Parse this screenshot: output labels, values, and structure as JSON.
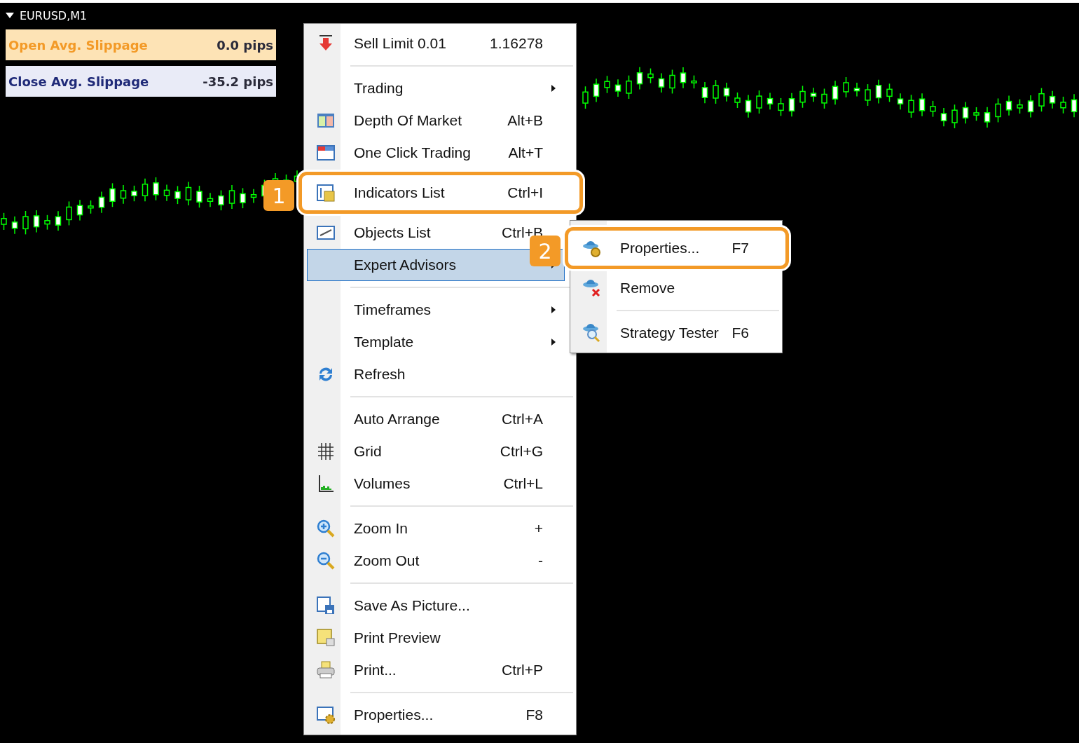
{
  "chart": {
    "symbol": "EURUSD,M1"
  },
  "slippage": [
    {
      "kind": "open",
      "label": "Open Avg. Slippage",
      "value": "0.0 pips",
      "color": "#f39a27"
    },
    {
      "kind": "close",
      "label": "Close Avg. Slippage",
      "value": "-35.2 pips",
      "color": "#1f2a78"
    }
  ],
  "context_menu": {
    "items": [
      {
        "kind": "item",
        "label": "Sell Limit 0.01",
        "shortcut": "1.16278",
        "submenu": false,
        "selected": false
      },
      {
        "kind": "separator"
      },
      {
        "kind": "item",
        "label": "Trading",
        "submenu": true,
        "selected": false
      },
      {
        "kind": "item",
        "label": "Depth Of Market",
        "shortcut": "Alt+B",
        "submenu": false,
        "selected": false
      },
      {
        "kind": "item",
        "label": "One Click Trading",
        "shortcut": "Alt+T",
        "submenu": false,
        "selected": false
      },
      {
        "kind": "item",
        "label": "Indicators List",
        "shortcut": "Ctrl+I",
        "submenu": false,
        "selected": false,
        "callout": "1"
      },
      {
        "kind": "item",
        "label": "Objects List",
        "shortcut": "Ctrl+B",
        "submenu": false,
        "selected": false
      },
      {
        "kind": "item",
        "label": "Expert Advisors",
        "submenu": true,
        "selected": true
      },
      {
        "kind": "separator"
      },
      {
        "kind": "item",
        "label": "Timeframes",
        "submenu": true,
        "selected": false
      },
      {
        "kind": "item",
        "label": "Template",
        "submenu": true,
        "selected": false
      },
      {
        "kind": "item",
        "label": "Refresh",
        "submenu": false,
        "selected": false
      },
      {
        "kind": "separator"
      },
      {
        "kind": "item",
        "label": "Auto Arrange",
        "shortcut": "Ctrl+A",
        "submenu": false,
        "selected": false
      },
      {
        "kind": "item",
        "label": "Grid",
        "shortcut": "Ctrl+G",
        "submenu": false,
        "selected": false
      },
      {
        "kind": "item",
        "label": "Volumes",
        "shortcut": "Ctrl+L",
        "submenu": false,
        "selected": false
      },
      {
        "kind": "separator"
      },
      {
        "kind": "item",
        "label": "Zoom In",
        "shortcut": "+",
        "submenu": false,
        "selected": false
      },
      {
        "kind": "item",
        "label": "Zoom Out",
        "shortcut": "-",
        "submenu": false,
        "selected": false
      },
      {
        "kind": "separator"
      },
      {
        "kind": "item",
        "label": "Save As Picture...",
        "submenu": false,
        "selected": false
      },
      {
        "kind": "item",
        "label": "Print Preview",
        "submenu": false,
        "selected": false
      },
      {
        "kind": "item",
        "label": "Print...",
        "shortcut": "Ctrl+P",
        "submenu": false,
        "selected": false
      },
      {
        "kind": "separator"
      },
      {
        "kind": "item",
        "label": "Properties...",
        "shortcut": "F8",
        "submenu": false,
        "selected": false
      }
    ]
  },
  "submenu": {
    "items": [
      {
        "kind": "item",
        "label": "Properties...",
        "shortcut": "F7",
        "submenu": false,
        "selected": false,
        "callout": "2"
      },
      {
        "kind": "item",
        "label": "Remove",
        "submenu": false,
        "selected": false
      },
      {
        "kind": "separator"
      },
      {
        "kind": "item",
        "label": "Strategy Tester",
        "shortcut": "F6",
        "submenu": false,
        "selected": false
      }
    ]
  }
}
